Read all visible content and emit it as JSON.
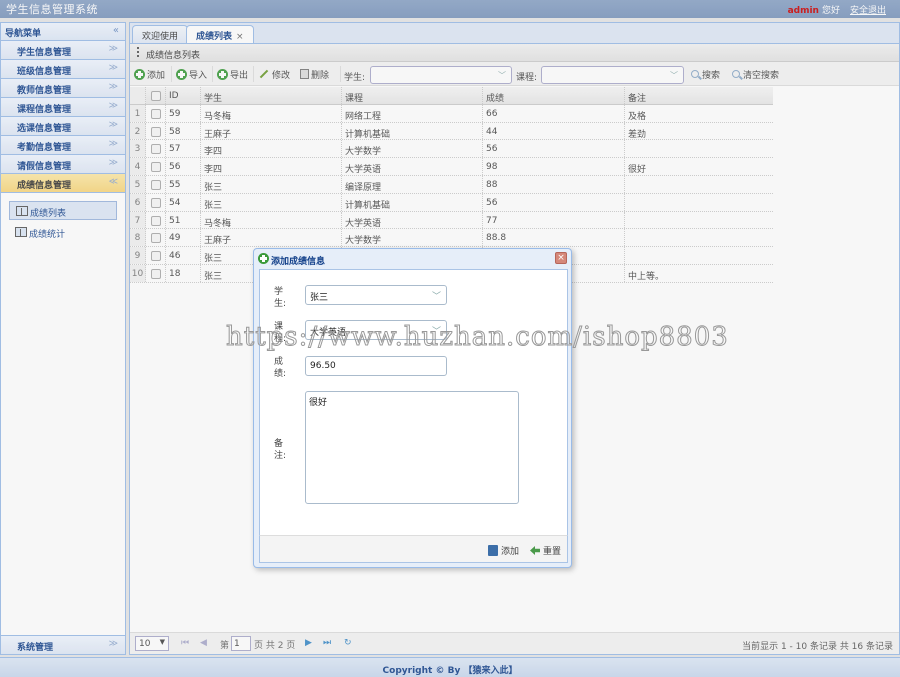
{
  "app": {
    "title": "学生信息管理系统",
    "user": "admin",
    "greeting": "您好",
    "logout": "安全退出"
  },
  "sidebar": {
    "header": "导航菜单",
    "collapse_icon": "«",
    "sections": [
      {
        "label": "学生信息管理",
        "expanded": false
      },
      {
        "label": "班级信息管理",
        "expanded": false
      },
      {
        "label": "教师信息管理",
        "expanded": false
      },
      {
        "label": "课程信息管理",
        "expanded": false
      },
      {
        "label": "选课信息管理",
        "expanded": false
      },
      {
        "label": "考勤信息管理",
        "expanded": false
      },
      {
        "label": "请假信息管理",
        "expanded": false
      },
      {
        "label": "成绩信息管理",
        "expanded": true
      }
    ],
    "sub_items": [
      {
        "label": "成绩列表",
        "selected": true
      },
      {
        "label": "成绩统计",
        "selected": false
      }
    ],
    "bottom_section": "系统管理",
    "chev_down": "≫",
    "chev_up": "≪"
  },
  "tabs": [
    {
      "label": "欢迎使用",
      "active": false
    },
    {
      "label": "成绩列表",
      "active": true,
      "close": "×"
    }
  ],
  "panel": {
    "title": "成绩信息列表"
  },
  "toolbar": {
    "add": "添加",
    "import": "导入",
    "export": "导出",
    "edit": "修改",
    "delete": "删除",
    "student_label": "学生:",
    "student_value": "",
    "course_label": "课程:",
    "course_value": "",
    "search": "搜索",
    "clear_search": "清空搜索"
  },
  "grid": {
    "columns": [
      "ID",
      "学生",
      "课程",
      "成绩",
      "备注"
    ],
    "rows": [
      {
        "n": "1",
        "id": "59",
        "student": "马冬梅",
        "course": "网络工程",
        "score": "66",
        "remark": "及格"
      },
      {
        "n": "2",
        "id": "58",
        "student": "王麻子",
        "course": "计算机基础",
        "score": "44",
        "remark": "差劲"
      },
      {
        "n": "3",
        "id": "57",
        "student": "李四",
        "course": "大学数学",
        "score": "56",
        "remark": ""
      },
      {
        "n": "4",
        "id": "56",
        "student": "李四",
        "course": "大学英语",
        "score": "98",
        "remark": "很好"
      },
      {
        "n": "5",
        "id": "55",
        "student": "张三",
        "course": "编译原理",
        "score": "88",
        "remark": ""
      },
      {
        "n": "6",
        "id": "54",
        "student": "张三",
        "course": "计算机基础",
        "score": "56",
        "remark": ""
      },
      {
        "n": "7",
        "id": "51",
        "student": "马冬梅",
        "course": "大学英语",
        "score": "77",
        "remark": ""
      },
      {
        "n": "8",
        "id": "49",
        "student": "王麻子",
        "course": "大学数学",
        "score": "88.8",
        "remark": ""
      },
      {
        "n": "9",
        "id": "46",
        "student": "张三",
        "course": "",
        "score": "",
        "remark": ""
      },
      {
        "n": "10",
        "id": "18",
        "student": "张三",
        "course": "",
        "score": "",
        "remark": "中上等。"
      }
    ]
  },
  "pager": {
    "page_size": "10",
    "page_label_pre": "第",
    "page": "1",
    "page_label_post": "页 共 2 页",
    "info": "当前显示 1 - 10 条记录 共 16 条记录",
    "first": "⏮",
    "prev": "◀",
    "next": "▶",
    "last": "⏭",
    "refresh": "↻"
  },
  "dialog": {
    "title": "添加成绩信息",
    "close": "×",
    "fields": {
      "student_label": "学生:",
      "student_value": "张三",
      "course_label": "课程:",
      "course_value": "大学英语",
      "score_label": "成绩:",
      "score_value": "96.50",
      "remark_label": "备注:",
      "remark_value": "很好"
    },
    "add_button": "添加",
    "reset_button": "重置"
  },
  "footer": {
    "copyright": "Copyright © By 【猿来入此】"
  },
  "watermark": "https://www.huzhan.com/ishop8803"
}
